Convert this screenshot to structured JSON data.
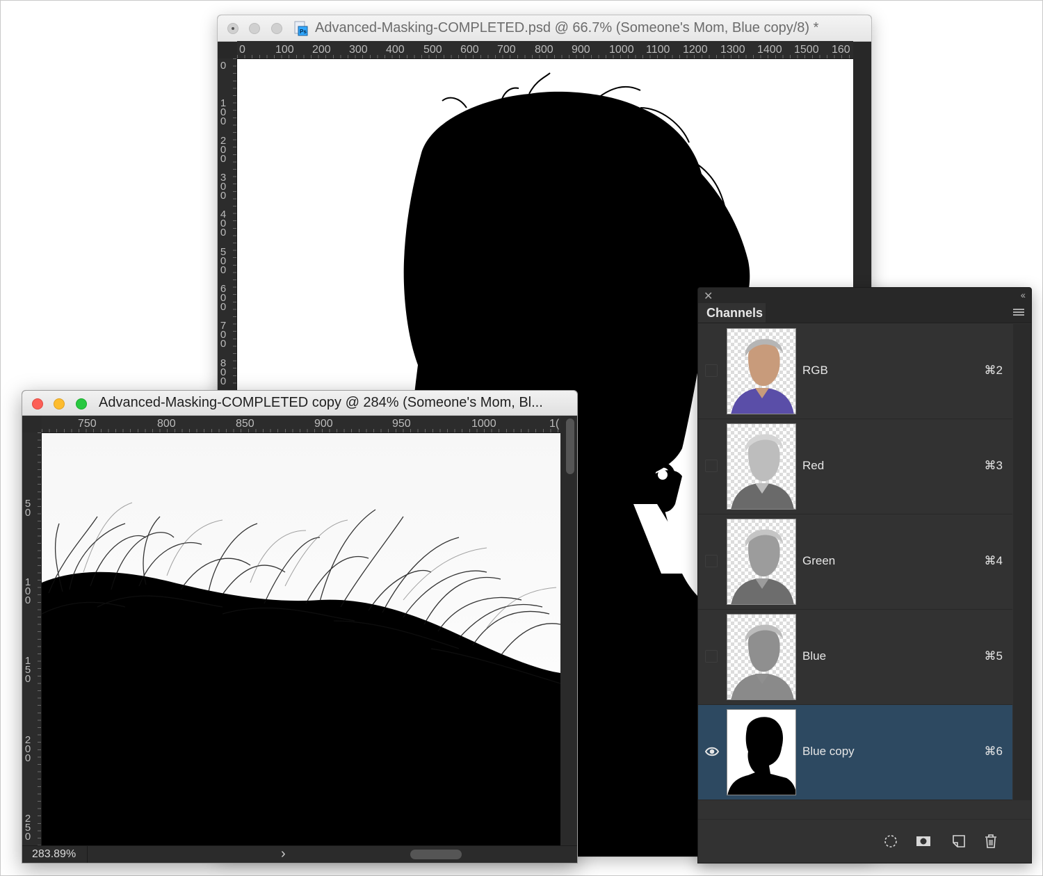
{
  "back_window": {
    "title": "Advanced-Masking-COMPLETED.psd @ 66.7% (Someone's Mom, Blue copy/8) *",
    "ruler_h": [
      "0",
      "100",
      "200",
      "300",
      "400",
      "500",
      "600",
      "700",
      "800",
      "900",
      "1000",
      "1100",
      "1200",
      "1300",
      "1400",
      "1500",
      "160"
    ],
    "ruler_v": [
      "0",
      "1\n0\n0",
      "2\n0\n0",
      "3\n0\n0",
      "4\n0\n0",
      "5\n0\n0",
      "6\n0\n0",
      "7\n0\n0",
      "8\n0\n0"
    ]
  },
  "front_window": {
    "title": "Advanced-Masking-COMPLETED copy @ 284% (Someone's Mom, Bl...",
    "ruler_h": [
      "750",
      "800",
      "850",
      "900",
      "950",
      "1000",
      "1("
    ],
    "ruler_v": [
      "5\n0",
      "1\n0\n0",
      "1\n5\n0",
      "2\n0\n0",
      "2\n5\n0"
    ],
    "zoom": "283.89%"
  },
  "channels_panel": {
    "tab_label": "Channels",
    "channels": [
      {
        "name": "RGB",
        "shortcut": "⌘2",
        "visible": false,
        "selected": false
      },
      {
        "name": "Red",
        "shortcut": "⌘3",
        "visible": false,
        "selected": false
      },
      {
        "name": "Green",
        "shortcut": "⌘4",
        "visible": false,
        "selected": false
      },
      {
        "name": "Blue",
        "shortcut": "⌘5",
        "visible": false,
        "selected": false
      },
      {
        "name": "Blue copy",
        "shortcut": "⌘6",
        "visible": true,
        "selected": true
      }
    ],
    "bottom_icons": [
      "load-selection-icon",
      "save-selection-icon",
      "new-channel-icon",
      "trash-icon"
    ]
  },
  "colors": {
    "selected_row": "#2d4961",
    "panel_bg": "#323232",
    "close_red": "#fc5f57",
    "minimize_yellow": "#fdbc2e",
    "zoom_green": "#28c840"
  }
}
